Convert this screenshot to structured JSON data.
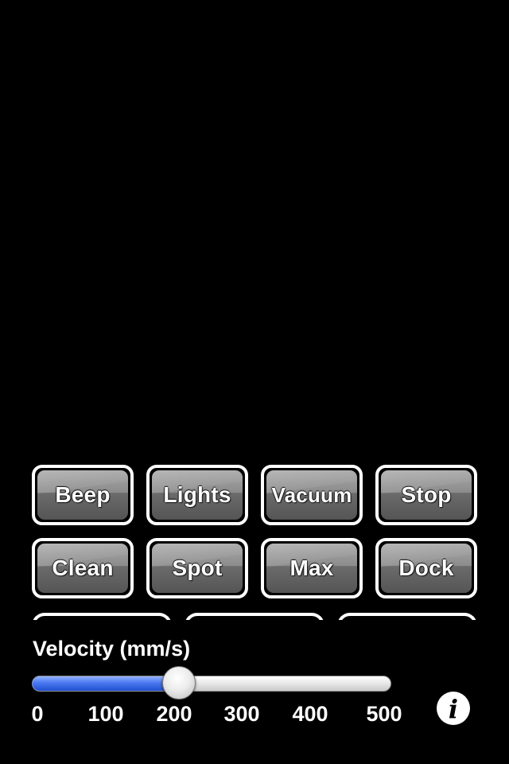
{
  "buttons": [
    {
      "name": "beep-button",
      "label": "Beep"
    },
    {
      "name": "lights-button",
      "label": "Lights"
    },
    {
      "name": "vacuum-button",
      "label": "Vacuum"
    },
    {
      "name": "stop-button",
      "label": "Stop"
    },
    {
      "name": "clean-button",
      "label": "Clean"
    },
    {
      "name": "spot-button",
      "label": "Spot"
    },
    {
      "name": "max-button",
      "label": "Max"
    },
    {
      "name": "dock-button",
      "label": "Dock"
    }
  ],
  "velocity": {
    "label": "Velocity (mm/s)",
    "value": 200,
    "min": 0,
    "max": 500,
    "ticks": [
      "0",
      "100",
      "200",
      "300",
      "400",
      "500"
    ]
  },
  "info": {
    "icon": "info-icon",
    "glyph": "i"
  },
  "colors": {
    "background": "#000000",
    "slider_fill": "#3a66e6"
  }
}
